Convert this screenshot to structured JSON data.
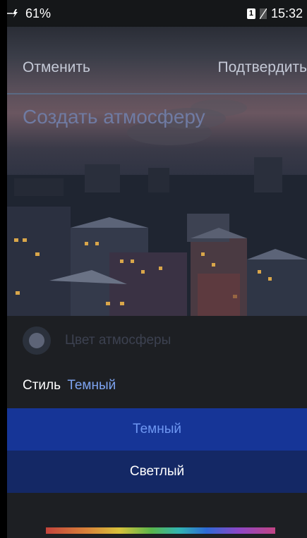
{
  "status_bar": {
    "battery_percent": "61%",
    "sim_number": "1",
    "time": "15:32"
  },
  "header": {
    "cancel_label": "Отменить",
    "confirm_label": "Подтвердить"
  },
  "title": "Создать атмосферу",
  "atmosphere_color": {
    "label": "Цвет атмосферы",
    "dot_color": "#5d6477"
  },
  "style": {
    "label": "Стиль",
    "value": "Темный",
    "options": [
      {
        "label": "Темный",
        "selected": true
      },
      {
        "label": "Светлый",
        "selected": false
      }
    ]
  },
  "colors": {
    "selected_option_bg": "#163597",
    "option_bg": "#142865",
    "accent_text": "#7da3f0"
  }
}
